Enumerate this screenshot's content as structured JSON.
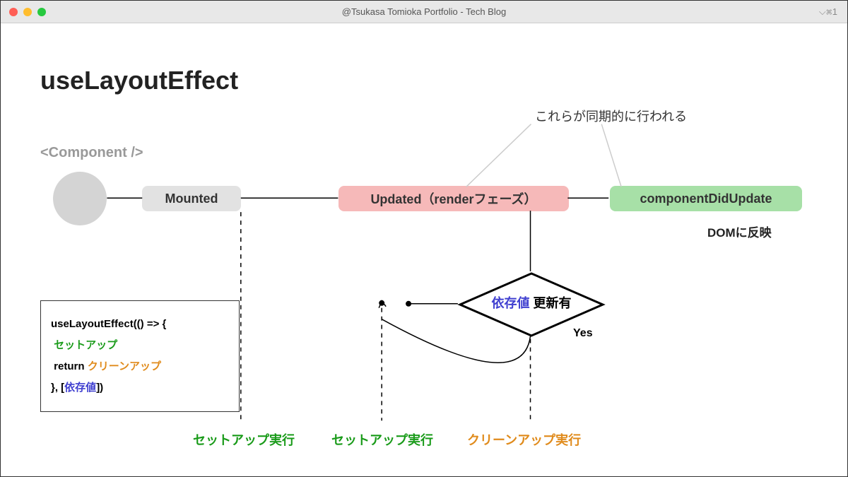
{
  "window": {
    "title": "@Tsukasa Tomioka Portfolio - Tech Blog",
    "shortcut": "⌵⌘1"
  },
  "heading": "useLayoutEffect",
  "syncNote": "これらが同期的に行われる",
  "componentLabel": "<Component />",
  "boxes": {
    "mounted": "Mounted",
    "updated": "Updated（renderフェーズ）",
    "componentDidUpdate": "componentDidUpdate"
  },
  "domReflect": "DOMに反映",
  "diamond": {
    "dep": "依存値",
    "update": " 更新有",
    "yes": "Yes"
  },
  "code": {
    "line1": "useLayoutEffect(() => {",
    "setup": "セットアップ",
    "returnKw": "return ",
    "cleanup": "クリーンアップ",
    "line4a": "}, [",
    "dep": "依存値",
    "line4b": "])"
  },
  "footerLabels": {
    "setup1": "セットアップ実行",
    "setup2": "セットアップ実行",
    "cleanup": "クリーンアップ実行"
  }
}
